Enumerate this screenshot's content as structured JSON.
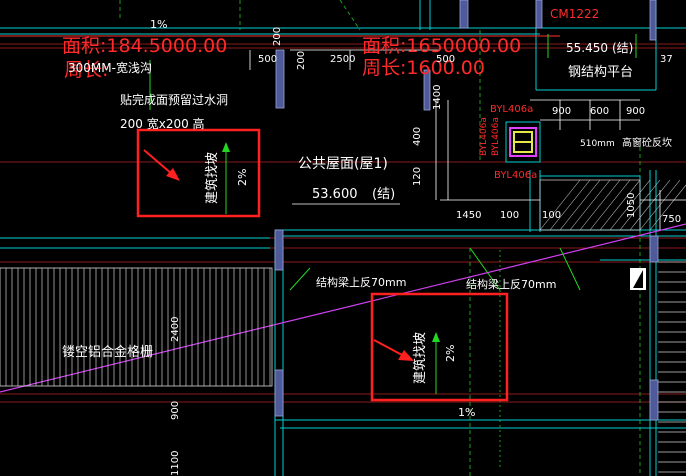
{
  "labels": {
    "area_label_1": "面积:184.5000.00",
    "area_label_2": "面积:1650000.00",
    "perimeter_label_1": "周长:",
    "perimeter_label_2": "周长:1600.00",
    "shallow_ditch": "300MM-宽浅沟",
    "overflow_note": "贴完成面预留过水洞",
    "overflow_size": "200  宽x200  高",
    "roof_name": "公共屋面(屋1)",
    "roof_elev": "53.600",
    "roof_elev_suffix": "(结)",
    "beam_note_1": "结构梁上反70mm",
    "beam_note_2": "结构梁上反70mm",
    "grille": "镂空铝合金格栅",
    "slope_label_1": "建筑找坡",
    "slope_pct_1": "2%",
    "slope_label_2": "建筑找坡",
    "slope_pct_2": "2%",
    "slope_top": "1%",
    "slope_bottom": "1%",
    "window_tag": "CM1222",
    "platform_elev": "55.450",
    "platform_elev_suffix": "(结)",
    "steel_platform": "钢结构平台",
    "tag_byl_a": "BYL406a",
    "tag_byl_b": "BYL406a",
    "tag_byl_c": "BYL406a",
    "tag_byl_d": "BYL406a",
    "high_sill": "高窗砼反坎",
    "dim_510": "510mm",
    "dim_500a": "500",
    "dim_200a": "200",
    "dim_2500": "2500",
    "dim_500b": "500",
    "dim_200b": "200",
    "dim_1450": "1450",
    "dim_100a": "100",
    "dim_100b": "100",
    "dim_900a": "900",
    "dim_600": "600",
    "dim_900b": "900",
    "dim_37": "37",
    "dim_750": "750",
    "dim_400": "400",
    "dim_120": "120",
    "dim_2400": "2400",
    "dim_900c": "900",
    "dim_1100": "1100",
    "dim_side_1": "1400",
    "dim_side_2": "1050"
  },
  "colors": {
    "background": "#000000",
    "dimension": "#ffffff",
    "annotation": "#22d822",
    "highlight": "#ff2a2a",
    "cyan": "#00e5e5",
    "magenta": "#e040ff",
    "wall": "#5a6ab0"
  }
}
